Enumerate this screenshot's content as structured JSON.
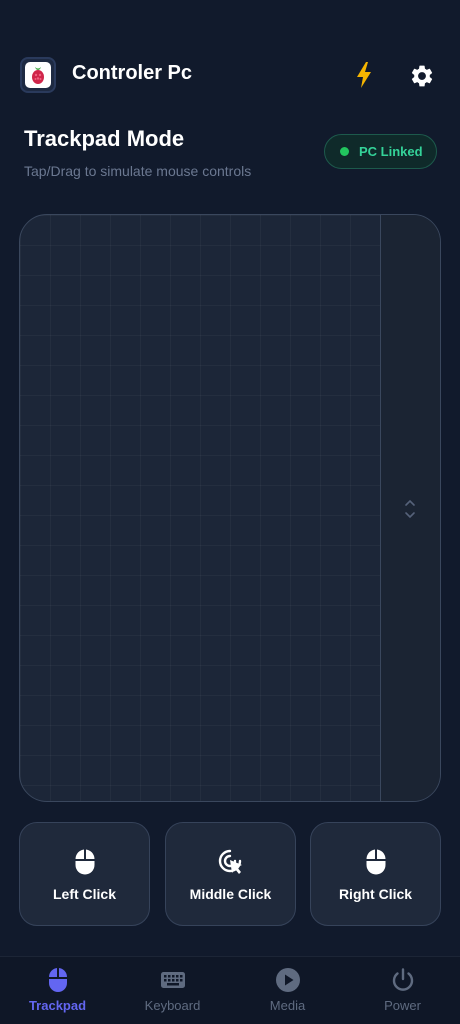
{
  "header": {
    "title": "Controler Pc",
    "logo_icon": "raspberry-logo",
    "bolt_icon": "bolt-icon",
    "settings_icon": "gear-icon",
    "bolt_color": "#f5b400"
  },
  "mode": {
    "title": "Trackpad Mode",
    "subtitle": "Tap/Drag to simulate mouse controls"
  },
  "status": {
    "label": "PC Linked",
    "color": "#22c55e"
  },
  "click_buttons": [
    {
      "label": "Left Click",
      "icon": "mouse-icon"
    },
    {
      "label": "Middle Click",
      "icon": "cursor-click-icon"
    },
    {
      "label": "Right Click",
      "icon": "mouse-icon"
    }
  ],
  "nav": {
    "items": [
      {
        "label": "Trackpad",
        "icon": "mouse-icon",
        "active": true
      },
      {
        "label": "Keyboard",
        "icon": "keyboard-icon",
        "active": false
      },
      {
        "label": "Media",
        "icon": "play-icon",
        "active": false
      },
      {
        "label": "Power",
        "icon": "power-icon",
        "active": false
      }
    ],
    "active_color": "#6366f1"
  }
}
